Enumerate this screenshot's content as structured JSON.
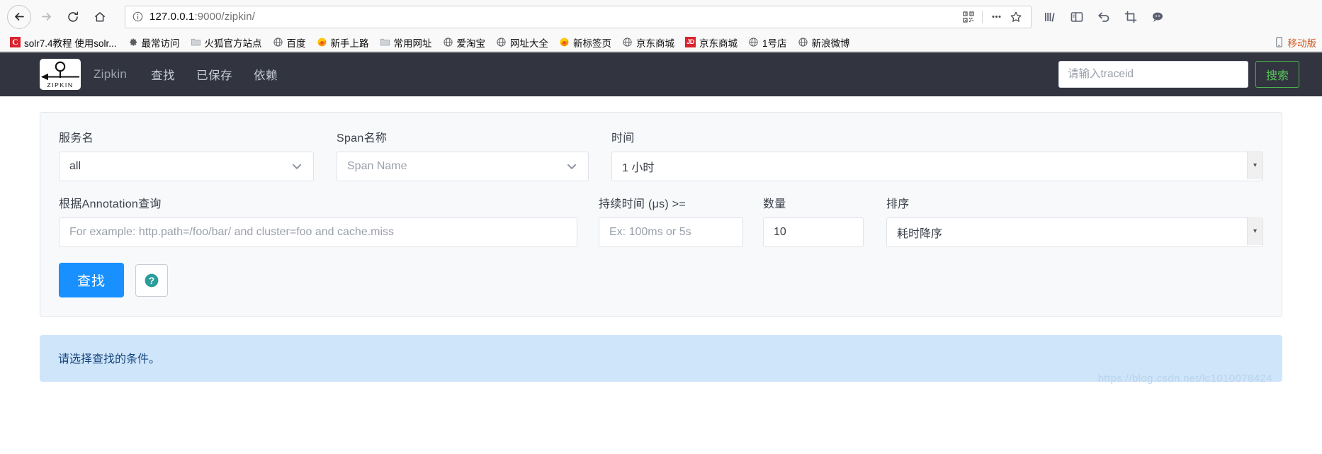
{
  "browser": {
    "nav": {
      "back": "back-arrow",
      "forward": "forward-arrow",
      "reload": "reload",
      "home": "home"
    },
    "url": {
      "host": "127.0.0.1",
      "rest": ":9000/zipkin/",
      "full": "127.0.0.1:9000/zipkin/",
      "info_icon": "info-icon"
    },
    "url_actions": [
      "qr-code-icon",
      "more-icon",
      "bookmark-star-icon"
    ],
    "toolbar_right": [
      "library-icon",
      "sidebar-icon",
      "undo-icon",
      "screenshot-icon",
      "chat-icon"
    ],
    "bookmarks": [
      {
        "label": "solr7.4教程 使用solr...",
        "icon": "solr-icon"
      },
      {
        "label": "最常访问",
        "icon": "gear-icon"
      },
      {
        "label": "火狐官方站点",
        "icon": "folder-icon"
      },
      {
        "label": "百度",
        "icon": "globe-icon"
      },
      {
        "label": "新手上路",
        "icon": "firefox-icon"
      },
      {
        "label": "常用网址",
        "icon": "folder-icon"
      },
      {
        "label": "爱淘宝",
        "icon": "globe-icon"
      },
      {
        "label": "网址大全",
        "icon": "globe-icon"
      },
      {
        "label": "新标签页",
        "icon": "firefox-icon"
      },
      {
        "label": "京东商城",
        "icon": "globe-icon"
      },
      {
        "label": "京东商城",
        "icon": "jd-icon"
      },
      {
        "label": "1号店",
        "icon": "globe-icon"
      },
      {
        "label": "新浪微博",
        "icon": "globe-icon"
      }
    ],
    "bookmarks_overflow": {
      "label": "移动版",
      "icon": "mobile-icon"
    }
  },
  "zipkin": {
    "brand": "Zipkin",
    "logo_text": "ZIPKIN",
    "nav": [
      {
        "label": "查找"
      },
      {
        "label": "已保存"
      },
      {
        "label": "依赖"
      }
    ],
    "trace_search": {
      "placeholder": "请输入traceid",
      "value": "",
      "button_label": "搜索"
    },
    "form": {
      "service": {
        "label": "服务名",
        "value": "all"
      },
      "span": {
        "label": "Span名称",
        "placeholder": "Span Name",
        "value": ""
      },
      "time": {
        "label": "时间",
        "value": "1 小时"
      },
      "annotation": {
        "label": "根据Annotation查询",
        "placeholder": "For example: http.path=/foo/bar/ and cluster=foo and cache.miss",
        "value": ""
      },
      "duration": {
        "label": "持续时间 (μs) >=",
        "placeholder": "Ex: 100ms or 5s",
        "value": ""
      },
      "count": {
        "label": "数量",
        "value": "10"
      },
      "sort": {
        "label": "排序",
        "value": "耗时降序"
      },
      "find_button": "查找",
      "help_icon": "help-circle-icon"
    },
    "alert": {
      "message": "请选择查找的条件。"
    },
    "watermark": "https://blog.csdn.net/lc1010078424"
  },
  "colors": {
    "header_bg": "#32353f",
    "primary_button": "#1890ff",
    "search_button_border": "#4caf50",
    "alert_bg": "#cfe5f9",
    "alert_text": "#15457e",
    "help_icon": "#2a9d9a"
  }
}
